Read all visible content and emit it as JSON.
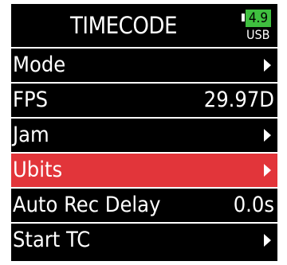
{
  "header": {
    "title": "TIMECODE",
    "battery_level": "4.9",
    "power_source": "USB"
  },
  "colors": {
    "background": "#000000",
    "selection": "#e2353a",
    "battery": "#3fbf3f"
  },
  "menu": {
    "items": [
      {
        "label": "Mode",
        "value": "",
        "icon": "arrow-right-icon"
      },
      {
        "label": "FPS",
        "value": "29.97D"
      },
      {
        "label": "Jam",
        "value": "",
        "icon": "arrow-right-icon"
      },
      {
        "label": "Ubits",
        "value": "",
        "icon": "arrow-right-icon",
        "selected": true
      },
      {
        "label": "Auto Rec Delay",
        "value": "0.0s"
      },
      {
        "label": "Start TC",
        "value": "",
        "icon": "arrow-right-icon"
      }
    ]
  }
}
